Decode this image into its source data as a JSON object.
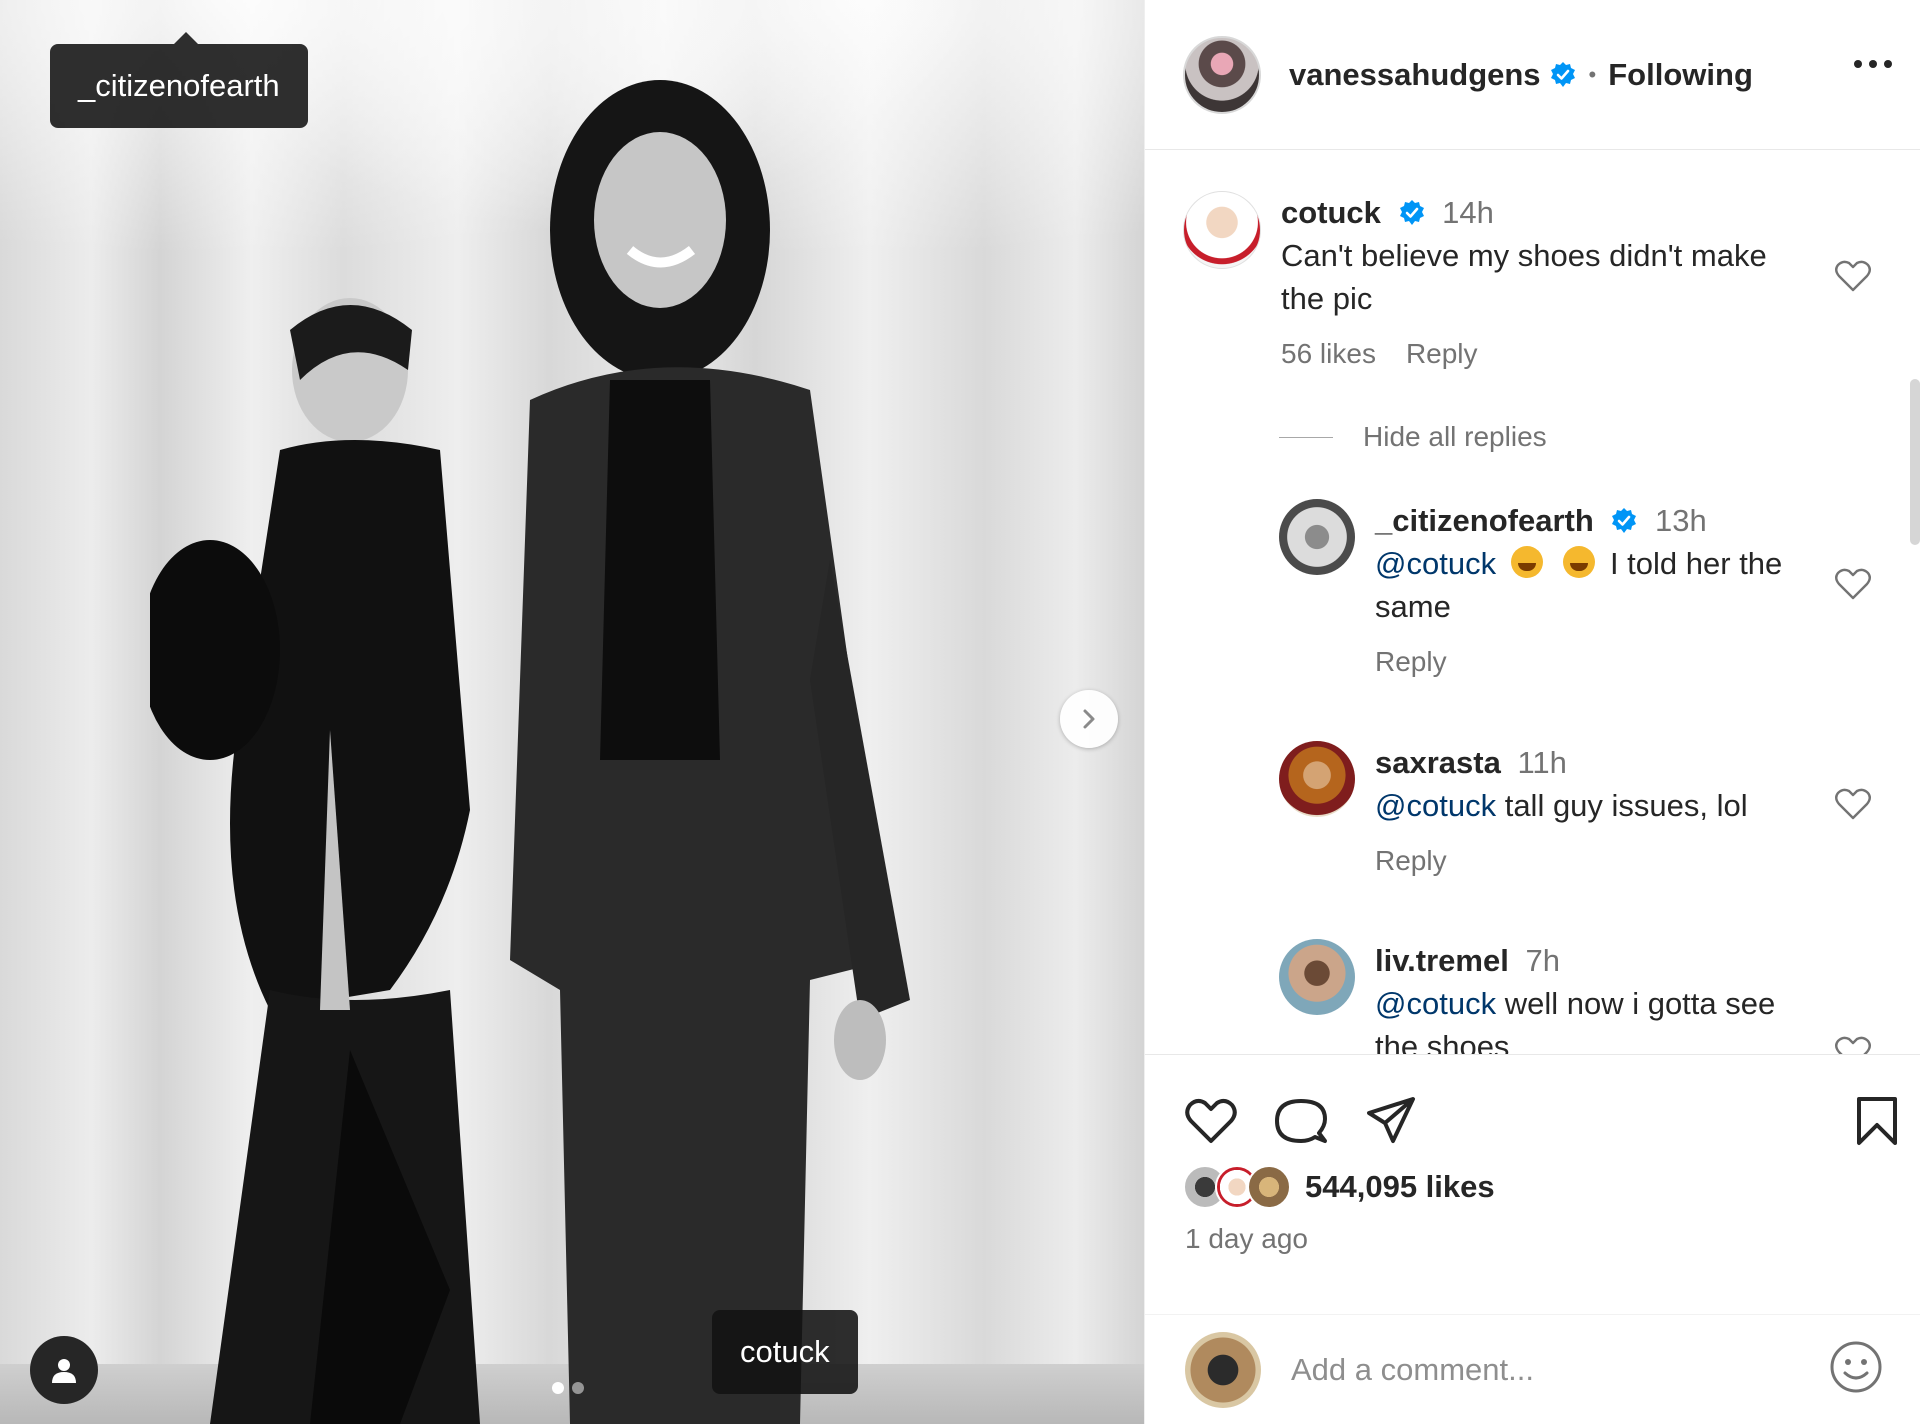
{
  "photo": {
    "tag_top": "_citizenofearth",
    "tag_bottom": "cotuck",
    "slide_count": 2,
    "current_slide": 1
  },
  "post_header": {
    "username": "vanessahudgens",
    "follow_status": "Following"
  },
  "comments": [
    {
      "username": "cotuck",
      "time": "14h",
      "text_line1": "Can't believe my shoes didn't make",
      "text_line2": "the pic",
      "likes": "56 likes",
      "reply_label": "Reply"
    }
  ],
  "hide_replies_label": "Hide all replies",
  "replies": [
    {
      "username": "_citizenofearth",
      "time": "13h",
      "mention": "@cotuck",
      "text_line1": "I told her the",
      "text_line2": "same",
      "reply_label": "Reply"
    },
    {
      "username": "saxrasta",
      "time": "11h",
      "mention": "@cotuck",
      "text": "tall guy issues, lol",
      "reply_label": "Reply"
    },
    {
      "username": "liv.tremel",
      "time": "7h",
      "mention": "@cotuck",
      "text_line1": "well now i gotta see",
      "text_line2": "the shoes"
    }
  ],
  "actions": {
    "likes": "544,095 likes",
    "time_ago": "1 day ago"
  },
  "add_comment": {
    "placeholder": "Add a comment..."
  },
  "colors": {
    "verified": "#0095f6",
    "mention": "#00376b",
    "secondary_text": "#737373"
  },
  "icons": [
    "heart-icon",
    "comment-icon",
    "share-icon",
    "bookmark-icon",
    "more-icon",
    "chevron-right-icon",
    "user-tag-icon",
    "smiley-icon",
    "verified-icon"
  ]
}
